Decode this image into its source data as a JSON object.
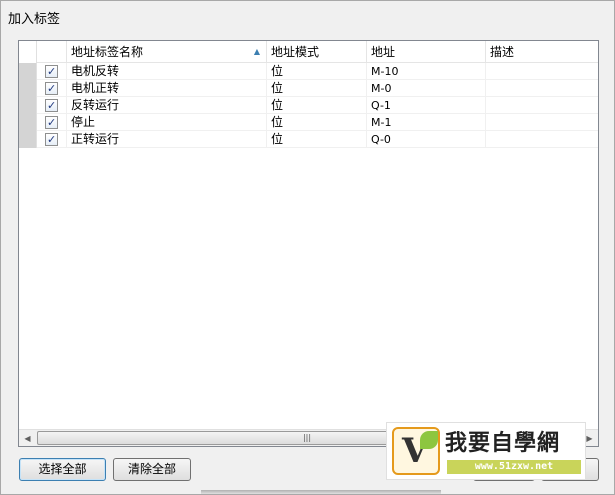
{
  "window": {
    "title": "加入标签"
  },
  "table": {
    "columns": [
      "地址标签名称",
      "地址模式",
      "地址",
      "描述"
    ],
    "rows": [
      {
        "checked": true,
        "name": "电机反转",
        "mode": "位",
        "address": "M-10",
        "desc": ""
      },
      {
        "checked": true,
        "name": "电机正转",
        "mode": "位",
        "address": "M-0",
        "desc": ""
      },
      {
        "checked": true,
        "name": "反转运行",
        "mode": "位",
        "address": "Q-1",
        "desc": ""
      },
      {
        "checked": true,
        "name": "停止",
        "mode": "位",
        "address": "M-1",
        "desc": ""
      },
      {
        "checked": true,
        "name": "正转运行",
        "mode": "位",
        "address": "Q-0",
        "desc": ""
      }
    ]
  },
  "buttons": {
    "select_all": "选择全部",
    "clear_all": "清除全部"
  },
  "watermark": {
    "title": "我要自學網",
    "url": "www.51zxw.net"
  },
  "colors": {
    "accent": "#3c7fb1",
    "check": "#21397f",
    "watermark_green": "#c9d45a"
  }
}
